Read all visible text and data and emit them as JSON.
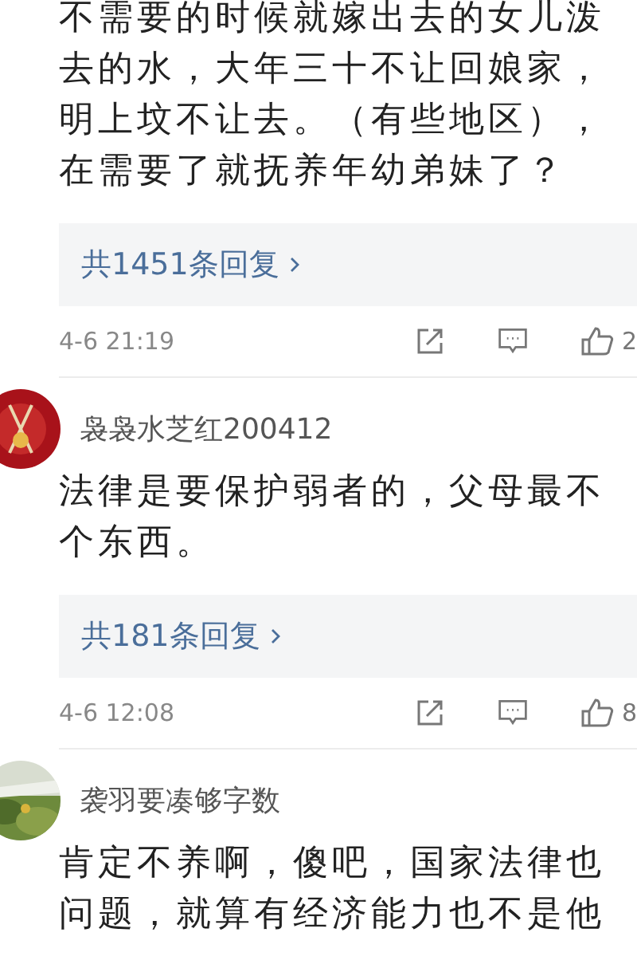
{
  "comments": [
    {
      "lines": [
        "不需要的时候就嫁出去的女儿泼",
        "去的水，大年三十不让回娘家，",
        "明上坟不让去。（有些地区），",
        "在需要了就抚养年幼弟妹了？"
      ],
      "replies": "共1451条回复",
      "time": "4-6 21:19",
      "likes": "2"
    },
    {
      "avatar": {
        "kind": "picture"
      },
      "name": "袅袅水芝红200412",
      "lines": [
        "法律是要保护弱者的，父母最不",
        "个东西。"
      ],
      "replies": "共181条回复",
      "time": "4-6 12:08",
      "likes": "8"
    },
    {
      "avatar": {
        "kind": "picture"
      },
      "name": "袭羽要凑够字数",
      "lines": [
        "肯定不养啊，傻吧，国家法律也",
        "问题，就算有经济能力也不是他"
      ]
    }
  ]
}
